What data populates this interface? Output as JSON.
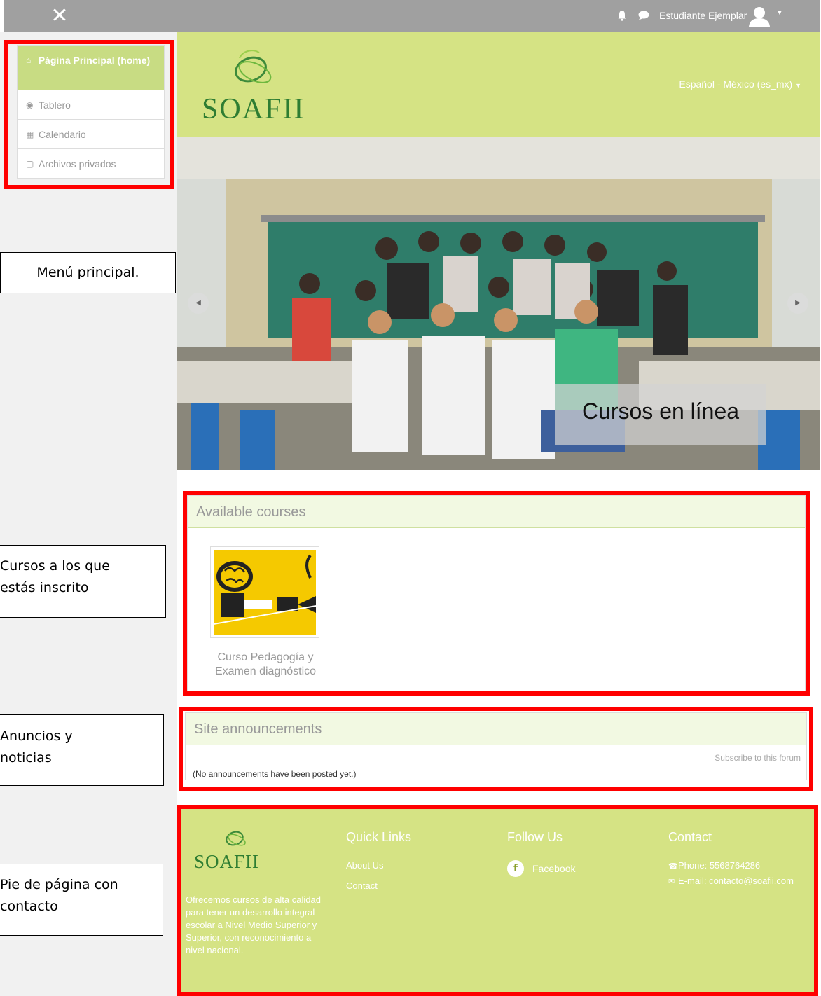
{
  "topbar": {
    "close_symbol": "✕",
    "username": "Estudiante Ejemplar",
    "icons": [
      "close-icon",
      "bell-icon",
      "chat-icon",
      "avatar-icon",
      "caret-down-icon"
    ]
  },
  "menu": {
    "items": [
      {
        "label": "Página Principal (home)",
        "icon": "home-icon",
        "active": true
      },
      {
        "label": "Tablero",
        "icon": "dashboard-icon",
        "active": false
      },
      {
        "label": "Calendario",
        "icon": "calendar-icon",
        "active": false
      },
      {
        "label": "Archivos privados",
        "icon": "file-icon",
        "active": false
      }
    ]
  },
  "callouts": {
    "menu": "Menú principal.",
    "courses_line1": "Cursos a los que",
    "courses_line2": "estás inscrito",
    "news_line1": "Anuncios y",
    "news_line2": "noticias",
    "footer_line1": "Pie de página con",
    "footer_line2": "contacto"
  },
  "header": {
    "brand": "SOAFII",
    "language": "Español - México (es_mx)"
  },
  "slider": {
    "caption": "Cursos en línea"
  },
  "courses": {
    "heading": "Available courses",
    "items": [
      {
        "name": "Curso Pedagogía y Examen diagnóstico"
      }
    ]
  },
  "announcements": {
    "heading": "Site announcements",
    "subscribe": "Subscribe to this forum",
    "empty": "(No announcements have been posted yet.)"
  },
  "footer": {
    "brand": "SOAFII",
    "description": "Ofrecemos cursos de alta calidad para tener un desarrollo integral escolar a Nivel Medio Superior y Superior, con reconocimiento a nivel nacional.",
    "quick_links_title": "Quick Links",
    "quick_links": [
      "About Us",
      "Contact"
    ],
    "follow_title": "Follow Us",
    "facebook": "Facebook",
    "contact_title": "Contact",
    "phone": "Phone: 5568764286",
    "email_label": "E-mail: ",
    "email": "contacto@soafii.com"
  },
  "colors": {
    "brand_green": "#d5e384",
    "active_menu": "#c8dc83",
    "annotation_red": "#ff0000",
    "topbar_gray": "#a0a0a0"
  }
}
